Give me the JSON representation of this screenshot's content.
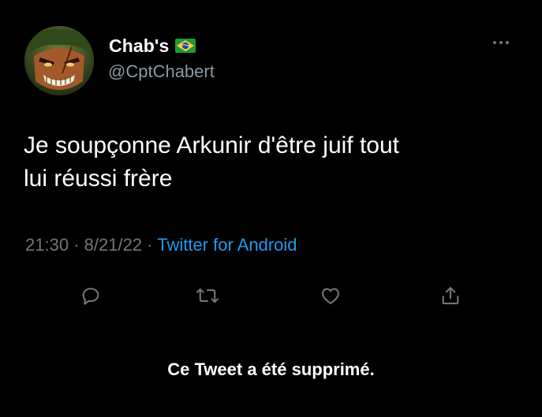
{
  "tweet": {
    "display_name": "Chab's",
    "handle": "@CptChabert",
    "flag_icon": "brazil-flag-icon",
    "text_line1": "Je soupçonne Arkunir d'être juif tout",
    "text_line2": "lui réussi frère",
    "time": "21:30",
    "date": "8/21/22",
    "separator": "·",
    "source": "Twitter for Android"
  },
  "actions": {
    "reply_icon": "reply-icon",
    "retweet_icon": "retweet-icon",
    "like_icon": "heart-icon",
    "share_icon": "share-icon"
  },
  "notice": {
    "deleted_text": "Ce Tweet a été supprimé."
  },
  "colors": {
    "background": "#000000",
    "text": "#ffffff",
    "secondary": "#71767b",
    "link": "#1d9bf0",
    "icon": "#71767b"
  }
}
